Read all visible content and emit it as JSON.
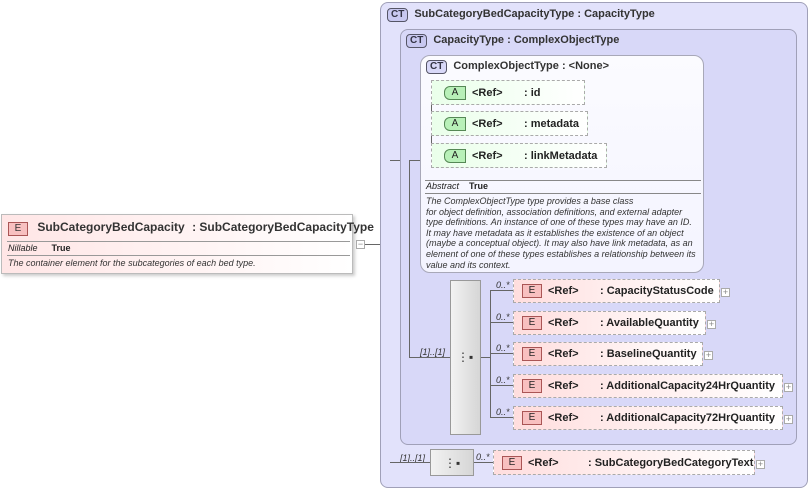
{
  "root": {
    "badge": "E",
    "name": "SubCategoryBedCapacity",
    "type": ": SubCategoryBedCapacityType",
    "prop_label": "Nillable",
    "prop_value": "True",
    "description": "The container element for the subcategories of each bed type."
  },
  "outer_type": {
    "badge": "CT",
    "name": "SubCategoryBedCapacityType",
    "base": ": CapacityType"
  },
  "inner_type": {
    "badge": "CT",
    "name": "CapacityType",
    "base": ": ComplexObjectType"
  },
  "base_type": {
    "badge": "CT",
    "name": "ComplexObjectType",
    "base": ": <None>",
    "abstract_label": "Abstract",
    "abstract_value": "True",
    "description": [
      "The ComplexObjectType type provides a base class",
      "for object definition, association definitions, and external adapter",
      "type definitions. An instance of one of these types may have an ID.",
      "It may have metadata as it establishes the existence of an object",
      "(maybe a conceptual object). It may also have link metadata, as an",
      "element of one of these types establishes a relationship between its",
      "value and its context."
    ]
  },
  "attributes": [
    {
      "badge": "A",
      "ref": "<Ref>",
      "name": ": id"
    },
    {
      "badge": "A",
      "ref": "<Ref>",
      "name": ": metadata"
    },
    {
      "badge": "A",
      "ref": "<Ref>",
      "name": ": linkMetadata"
    }
  ],
  "capacity_sequence": {
    "multiplicity": "[1]..[1]"
  },
  "capacity_elements": [
    {
      "badge": "E",
      "ref": "<Ref>",
      "name": ": CapacityStatusCode",
      "multiplicity": "0..*"
    },
    {
      "badge": "E",
      "ref": "<Ref>",
      "name": ": AvailableQuantity",
      "multiplicity": "0..*"
    },
    {
      "badge": "E",
      "ref": "<Ref>",
      "name": ": BaselineQuantity",
      "multiplicity": "0..*"
    },
    {
      "badge": "E",
      "ref": "<Ref>",
      "name": ": AdditionalCapacity24HrQuantity",
      "multiplicity": "0..*"
    },
    {
      "badge": "E",
      "ref": "<Ref>",
      "name": ": AdditionalCapacity72HrQuantity",
      "multiplicity": "0..*"
    }
  ],
  "sub_sequence": {
    "multiplicity": "[1]..[1]"
  },
  "sub_element": {
    "badge": "E",
    "ref": "<Ref>",
    "name": ": SubCategoryBedCategoryText",
    "multiplicity": "0..*"
  }
}
